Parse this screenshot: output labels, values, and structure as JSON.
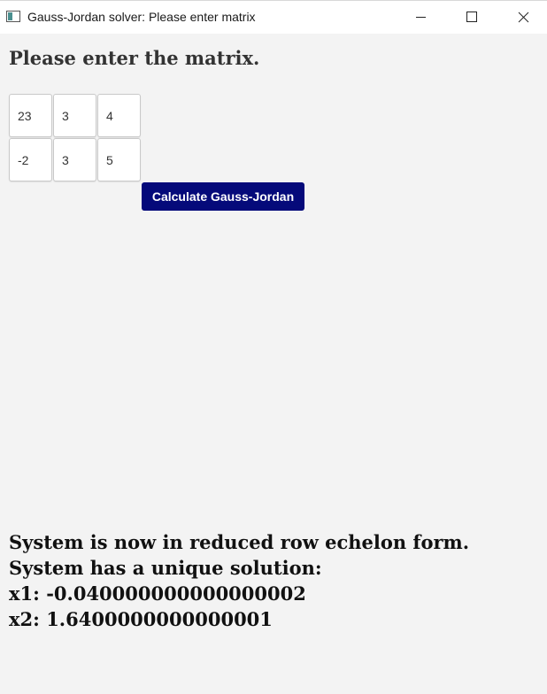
{
  "window": {
    "title": "Gauss-Jordan solver: Please enter matrix"
  },
  "icons": {
    "app": "window-icon",
    "minimize": "minimize-icon",
    "maximize": "maximize-icon",
    "close": "close-icon"
  },
  "main": {
    "heading": "Please enter the matrix.",
    "matrix": [
      [
        "23",
        "3",
        "4"
      ],
      [
        "-2",
        "3",
        "5"
      ]
    ],
    "calculate_label": "Calculate Gauss-Jordan"
  },
  "results": {
    "line1": "System is now in reduced row echelon form.",
    "line2": "System has a unique solution:",
    "line3": "x1: -0.040000000000000002",
    "line4": "x2: 1.6400000000000001"
  },
  "colors": {
    "button": "#050a7a",
    "background": "#f3f3f3"
  }
}
